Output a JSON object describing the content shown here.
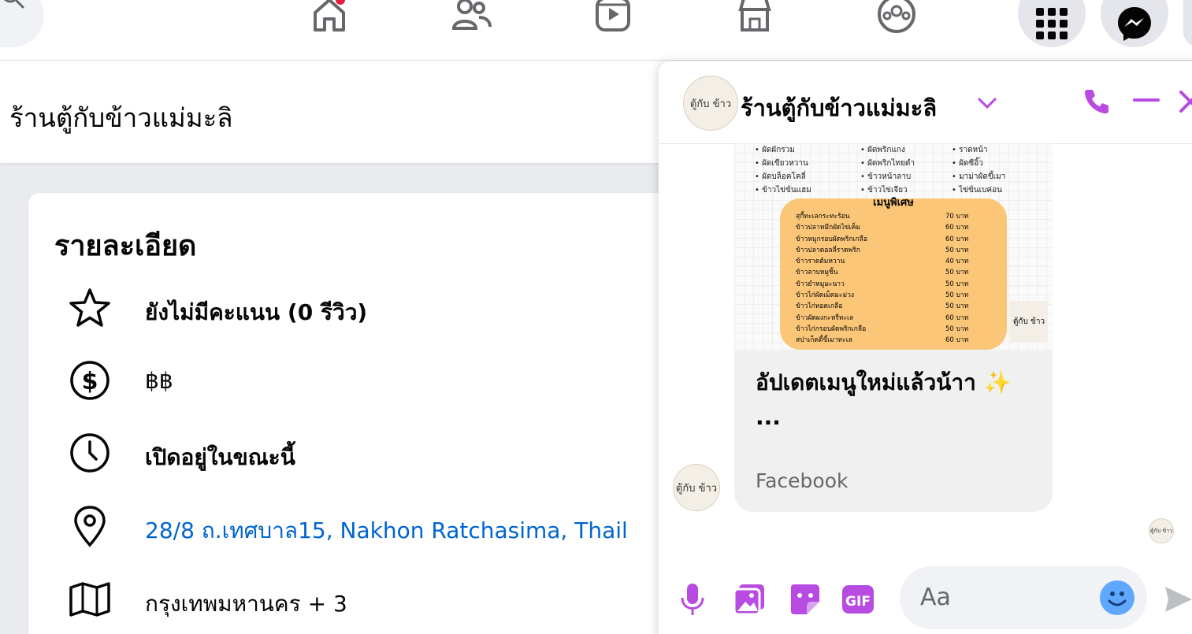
{
  "topbar": {
    "icons": [
      "search-icon",
      "home-icon",
      "friends-icon",
      "video-icon",
      "marketplace-icon",
      "groups-icon",
      "menu-grid-icon",
      "messenger-icon"
    ],
    "colors": {
      "badge": "#e41e3f"
    }
  },
  "page_header": {
    "name": "ร้านตู้กับข้าวแม่มะลิ"
  },
  "details": {
    "title": "รายละเอียด",
    "rating": "ยังไม่มีคะแนน (0 รีวิว)",
    "price": "฿฿",
    "hours": "เปิดอยู่ในขณะนี้",
    "address": "28/8 ถ.เทศบาล15, Nakhon Ratchasima, Thail",
    "area": "กรุงเทพมหานคร + 3",
    "colors": {
      "link": "#0064d1"
    }
  },
  "chat": {
    "title": "ร้านตู้กับข้าวแม่มะลิ",
    "avatar_text": "ตู้กับ ข้าว",
    "message": "อัปเดตเมนูใหม่แล้วน้าา ✨",
    "ellipsis": "...",
    "source": "Facebook",
    "input_placeholder": "Aa",
    "colors": {
      "accent": "#b74be2",
      "emoji": "#5ea8ff"
    },
    "menu": {
      "col1": [
        "• ผัดผักรวม",
        "• ผัดเขียวหวาน",
        "• ผัดบล็อคโคลี่",
        "• ข้าวไข่ข้นแฮม"
      ],
      "col2": [
        "• ผัดพริกแกง",
        "• ผัดพริกไทยดำ",
        "• ข้าวหน้าลาบ",
        "• ข้าวไข่เจียว"
      ],
      "col3": [
        "• ราดหน้า",
        "• ผัดซีอิ๊ว",
        "• มาม่าผัดขี้เมา",
        "• ไข่ข้นเบค่อน"
      ],
      "special_title": "เมนูพิเศษ",
      "special_items": [
        "สุกี้ทะเลกระทะร้อน",
        "ข้าวปลาหมึกผัดไข่เค็ม",
        "ข้าวหมูกรอบผัดพริกเกลือ",
        "ข้าวปลาดอลลี่ราดพริก",
        "ข้าวราดต้มหวาน",
        "ข้าวลาบหมูชิ้น",
        "ข้าวยำหมูมะนาว",
        "ข้าวไก่ผัดเม็ดมะม่วง",
        "ข้าวไก่ทอดเกลือ",
        "ข้าวผัดผงกะหรี่ทะเล",
        "ข้าวไก่กรอบผัดพริกเกลือ",
        "สปาเก็ตตี้ขี้เมาทะเล"
      ],
      "special_prices": [
        "70 บาท",
        "60 บาท",
        "60 บาท",
        "50 บาท",
        "40 บาท",
        "50 บาท",
        "50 บาท",
        "50 บาท",
        "50 บาท",
        "60 บาท",
        "50 บาท",
        "60 บาท"
      ]
    }
  }
}
